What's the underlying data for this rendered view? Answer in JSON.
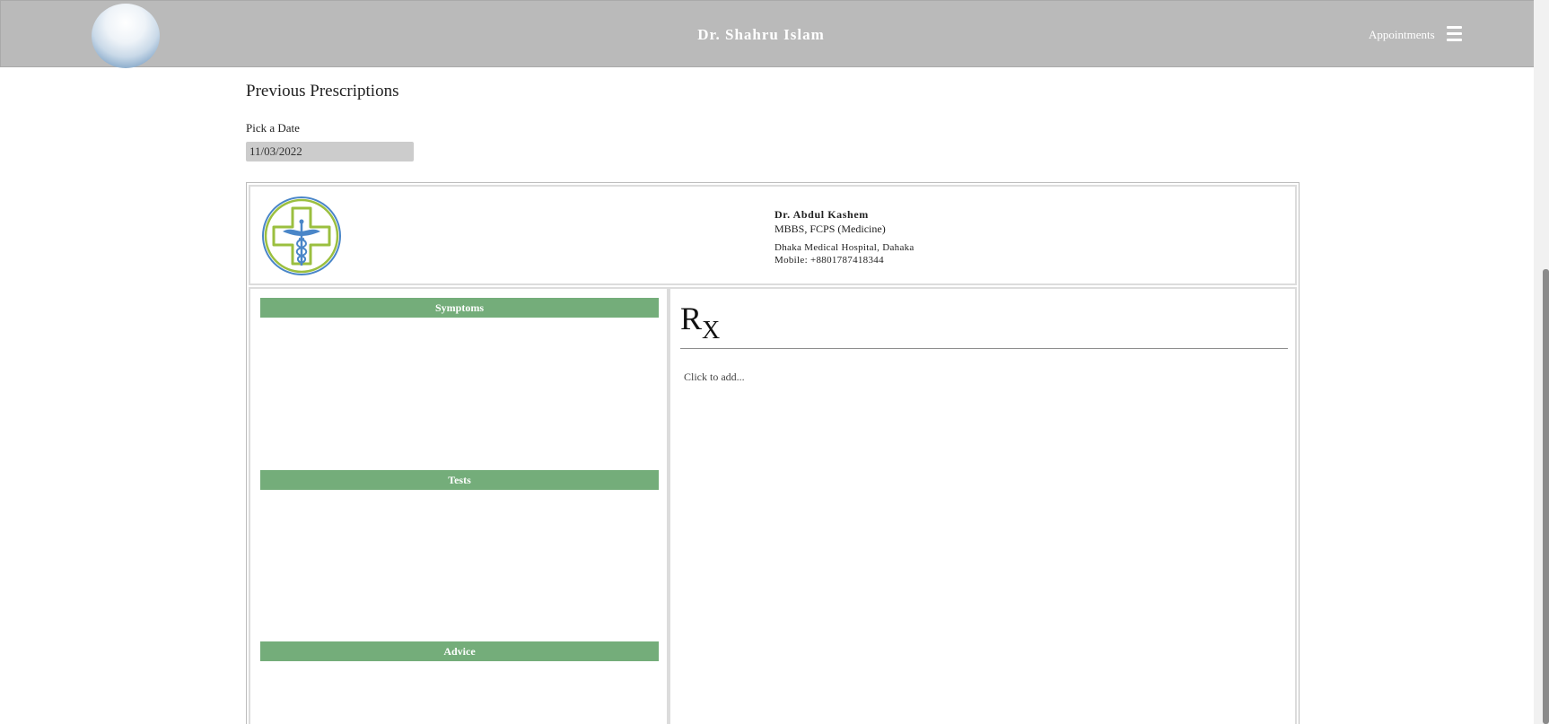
{
  "header": {
    "title": "Dr. Shahru Islam",
    "nav_link": "Appointments",
    "avatar_icon": "avatar-image",
    "menu_icon": "hamburger-menu-icon"
  },
  "page": {
    "heading": "Previous Prescriptions",
    "date_label": "Pick a Date",
    "date_value": "11/03/2022"
  },
  "prescription": {
    "logo_icon": "medical-caduceus-cross-logo",
    "doctor_name": "Dr. Abdul Kashem",
    "degrees": "MBBS, FCPS (Medicine)",
    "hospital": "Dhaka Medical Hospital, Dahaka",
    "mobile": "Mobile: +8801787418344",
    "sections": {
      "symptoms": "Symptoms",
      "tests": "Tests",
      "advice": "Advice"
    },
    "rx_main": "R",
    "rx_sub": "X",
    "click_to_add": "Click to add..."
  },
  "colors": {
    "topbar": "#bababa",
    "section_bar": "#74ad7a",
    "logo_green": "#9bbf3f",
    "logo_blue": "#4a86c8"
  }
}
